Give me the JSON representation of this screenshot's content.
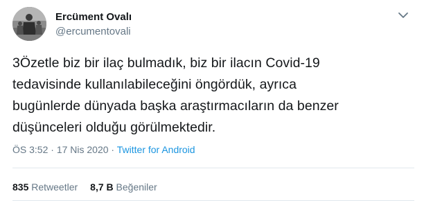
{
  "user": {
    "display_name": "Ercüment Ovalı",
    "handle": "@ercumentovali",
    "avatar_icon": "avatar-photo"
  },
  "tweet": {
    "lines": [
      "3Özetle biz bir ilaç bulmadık, biz bir ilacın Covid-19",
      "tedavisinde kullanılabileceğini öngördük, ayrıca",
      "bugünlerde dünyada başka araştırmacıların da benzer",
      "düşünceleri olduğu görülmektedir."
    ]
  },
  "meta": {
    "time": "ÖS 3:52",
    "separator": " · ",
    "date": "17 Nis 2020",
    "source": "Twitter for Android"
  },
  "stats": {
    "retweets_count": "835",
    "retweets_label": "Retweetler",
    "likes_count": "8,7 B",
    "likes_label": "Beğeniler"
  },
  "colors": {
    "text": "#14171a",
    "secondary": "#657786",
    "link": "#1b95e0",
    "divider": "#e1e8ed"
  },
  "icons": {
    "menu": "chevron-down-icon"
  }
}
